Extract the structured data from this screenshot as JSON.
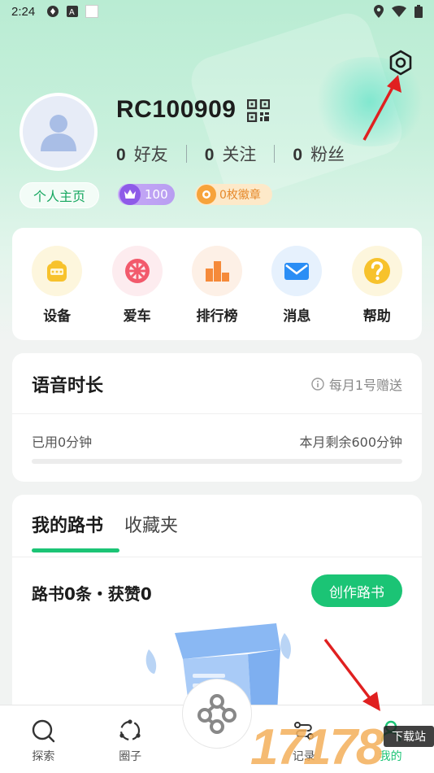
{
  "status_bar": {
    "time": "2:24"
  },
  "profile": {
    "username": "RC100909",
    "stats": [
      {
        "value": "0",
        "label": "好友"
      },
      {
        "value": "0",
        "label": "关注"
      },
      {
        "value": "0",
        "label": "粉丝"
      }
    ],
    "homepage_label": "个人主页",
    "level": "100",
    "medals": "0枚徽章"
  },
  "quick_actions": [
    {
      "label": "设备",
      "icon": "device-icon",
      "bg": "#fdf6dd"
    },
    {
      "label": "爱车",
      "icon": "wheel-icon",
      "bg": "#fdecef"
    },
    {
      "label": "排行榜",
      "icon": "leaderboard-icon",
      "bg": "#fdf0e6"
    },
    {
      "label": "消息",
      "icon": "mail-icon",
      "bg": "#e6f1fd"
    },
    {
      "label": "帮助",
      "icon": "help-icon",
      "bg": "#fdf6dd"
    }
  ],
  "voice": {
    "title": "语音时长",
    "note": "每月1号赠送",
    "used": "已用0分钟",
    "remaining": "本月剩余600分钟",
    "used_fraction": 0
  },
  "roadbooks": {
    "tabs": [
      "我的路书",
      "收藏夹"
    ],
    "active_tab": 0,
    "summary": "路书0条・获赞0",
    "create_label": "创作路书"
  },
  "tabbar": [
    {
      "label": "探索",
      "icon": "explore-icon"
    },
    {
      "label": "圈子",
      "icon": "circle-icon"
    },
    {
      "label": "记录",
      "icon": "record-icon"
    },
    {
      "label": "我的",
      "icon": "profile-icon",
      "active": true
    }
  ],
  "watermark": {
    "digits": "17178",
    "brand": "下载站"
  },
  "colors": {
    "accent": "#1bc475",
    "hero": "#c8f0dc",
    "annotation": "#e02020"
  }
}
